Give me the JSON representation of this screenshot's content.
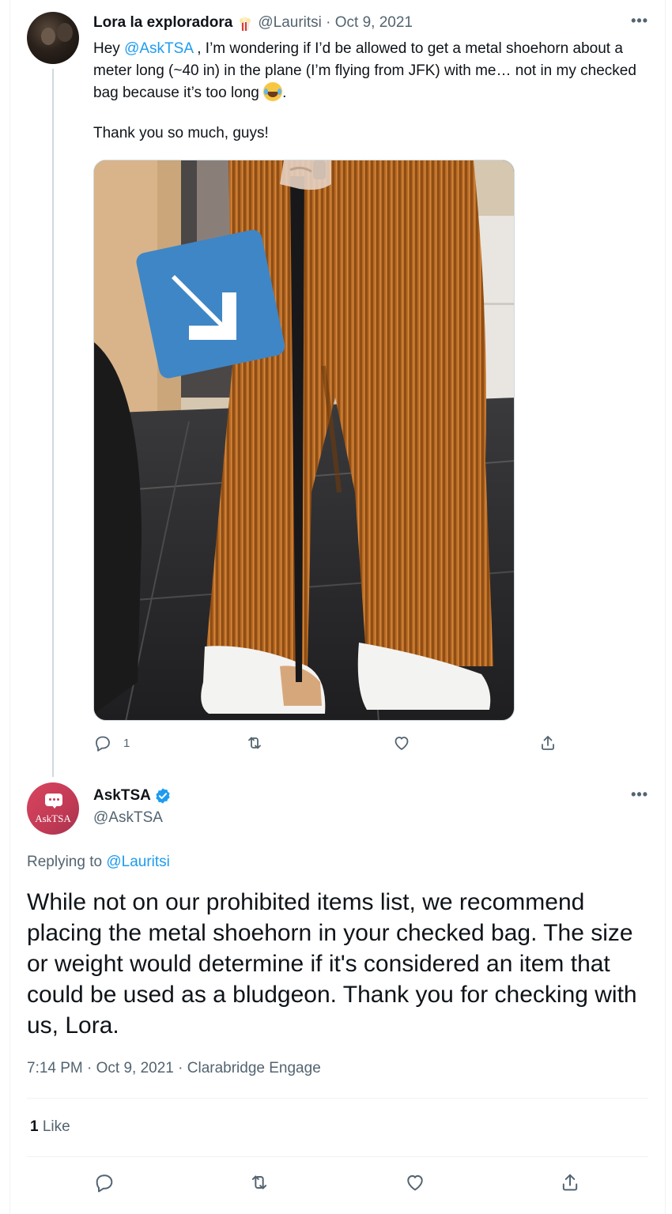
{
  "original_tweet": {
    "display_name": "Lora la exploradora",
    "name_emoji": "popcorn-emoji",
    "handle_date": "@Lauritsi · Oct 9, 2021",
    "text_prefix": "Hey ",
    "mention": "@AskTSA",
    "text_body": " , I’m wondering if I’d be allowed to get a metal shoehorn about a meter long (~40 in) in the plane (I’m flying from JFK) with me… not in my checked bag because it’s too long ",
    "text_suffix": ".",
    "text_emoji": "face-with-tears-of-joy-emoji",
    "thanks": "Thank you so much, guys!",
    "reply_count": "1",
    "retweet_count": "",
    "like_count": ""
  },
  "reply_tweet": {
    "display_name": "AskTSA",
    "handle": "@AskTSA",
    "avatar_text": "AskTSA",
    "replying_label": "Replying to ",
    "replying_to": "@Lauritsi",
    "text": "While not on our prohibited items list, we recommend placing the metal shoehorn in your checked bag. The size or weight would determine if it's considered an item that could be used as a bludgeon. Thank you for checking with us, Lora.",
    "meta": "7:14 PM · Oct 9, 2021 · Clarabridge Engage",
    "likes_count": "1",
    "likes_label": " Like"
  },
  "icons": [
    "more-icon",
    "reply-icon",
    "retweet-icon",
    "like-icon",
    "share-icon",
    "verified-badge-icon"
  ],
  "colors": {
    "accent": "#1d9bf0",
    "secondary_text": "#536471",
    "primary_text": "#0f1419",
    "avatar_asktsa": "#c23a55"
  }
}
